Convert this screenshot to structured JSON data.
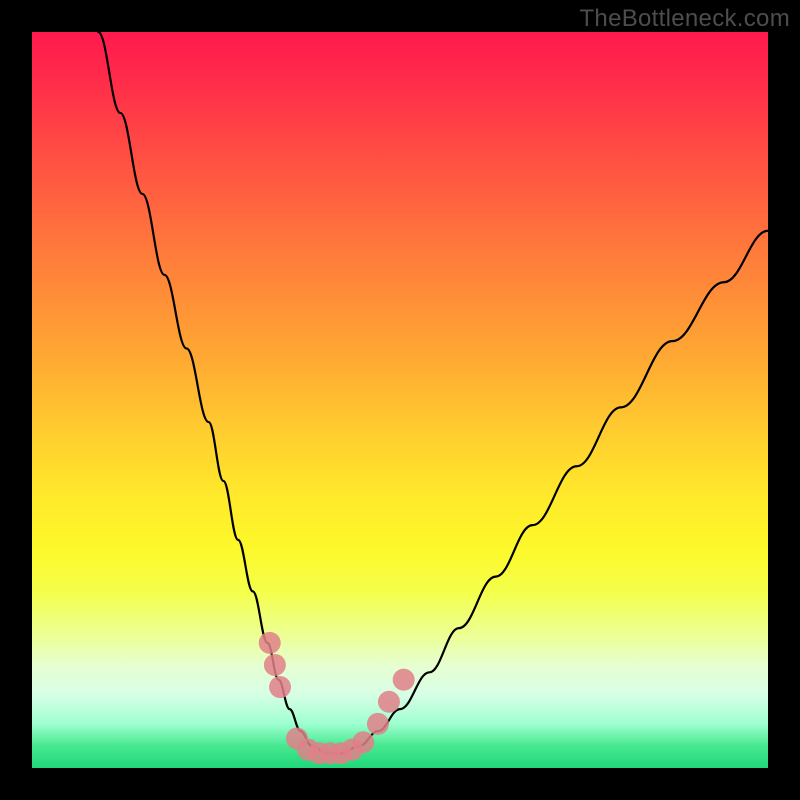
{
  "watermark": "TheBottleneck.com",
  "chart_data": {
    "type": "line",
    "title": "",
    "xlabel": "",
    "ylabel": "",
    "xlim": [
      0,
      100
    ],
    "ylim": [
      0,
      100
    ],
    "series": [
      {
        "name": "bottleneck-curve",
        "x": [
          9,
          12,
          15,
          18,
          21,
          24,
          26,
          28,
          30,
          32,
          33.5,
          35,
          36.5,
          38,
          40,
          42,
          44.5,
          47,
          50,
          54,
          58,
          63,
          68,
          74,
          80,
          87,
          94,
          100
        ],
        "values": [
          100,
          89,
          78,
          67,
          57,
          47,
          39,
          31,
          24,
          17,
          12,
          8,
          5,
          3,
          2,
          2,
          3,
          5,
          8,
          13,
          19,
          26,
          33,
          41,
          49,
          58,
          66,
          73
        ]
      }
    ],
    "markers": {
      "name": "highlight-points",
      "color": "#e08088",
      "points": [
        {
          "x": 32.3,
          "y": 17
        },
        {
          "x": 33.0,
          "y": 14
        },
        {
          "x": 33.7,
          "y": 11
        },
        {
          "x": 36.0,
          "y": 4
        },
        {
          "x": 37.5,
          "y": 2.5
        },
        {
          "x": 39.0,
          "y": 2
        },
        {
          "x": 40.5,
          "y": 2
        },
        {
          "x": 42.0,
          "y": 2
        },
        {
          "x": 43.5,
          "y": 2.5
        },
        {
          "x": 45.0,
          "y": 3.5
        },
        {
          "x": 47.0,
          "y": 6
        },
        {
          "x": 48.5,
          "y": 9
        },
        {
          "x": 50.5,
          "y": 12
        }
      ]
    },
    "gradient_stops": [
      {
        "pos": 0,
        "color": "#ff1a4d"
      },
      {
        "pos": 25,
        "color": "#ff6a3e"
      },
      {
        "pos": 55,
        "color": "#ffcf2f"
      },
      {
        "pos": 76,
        "color": "#f4ff4a"
      },
      {
        "pos": 100,
        "color": "#1fd77a"
      }
    ]
  }
}
